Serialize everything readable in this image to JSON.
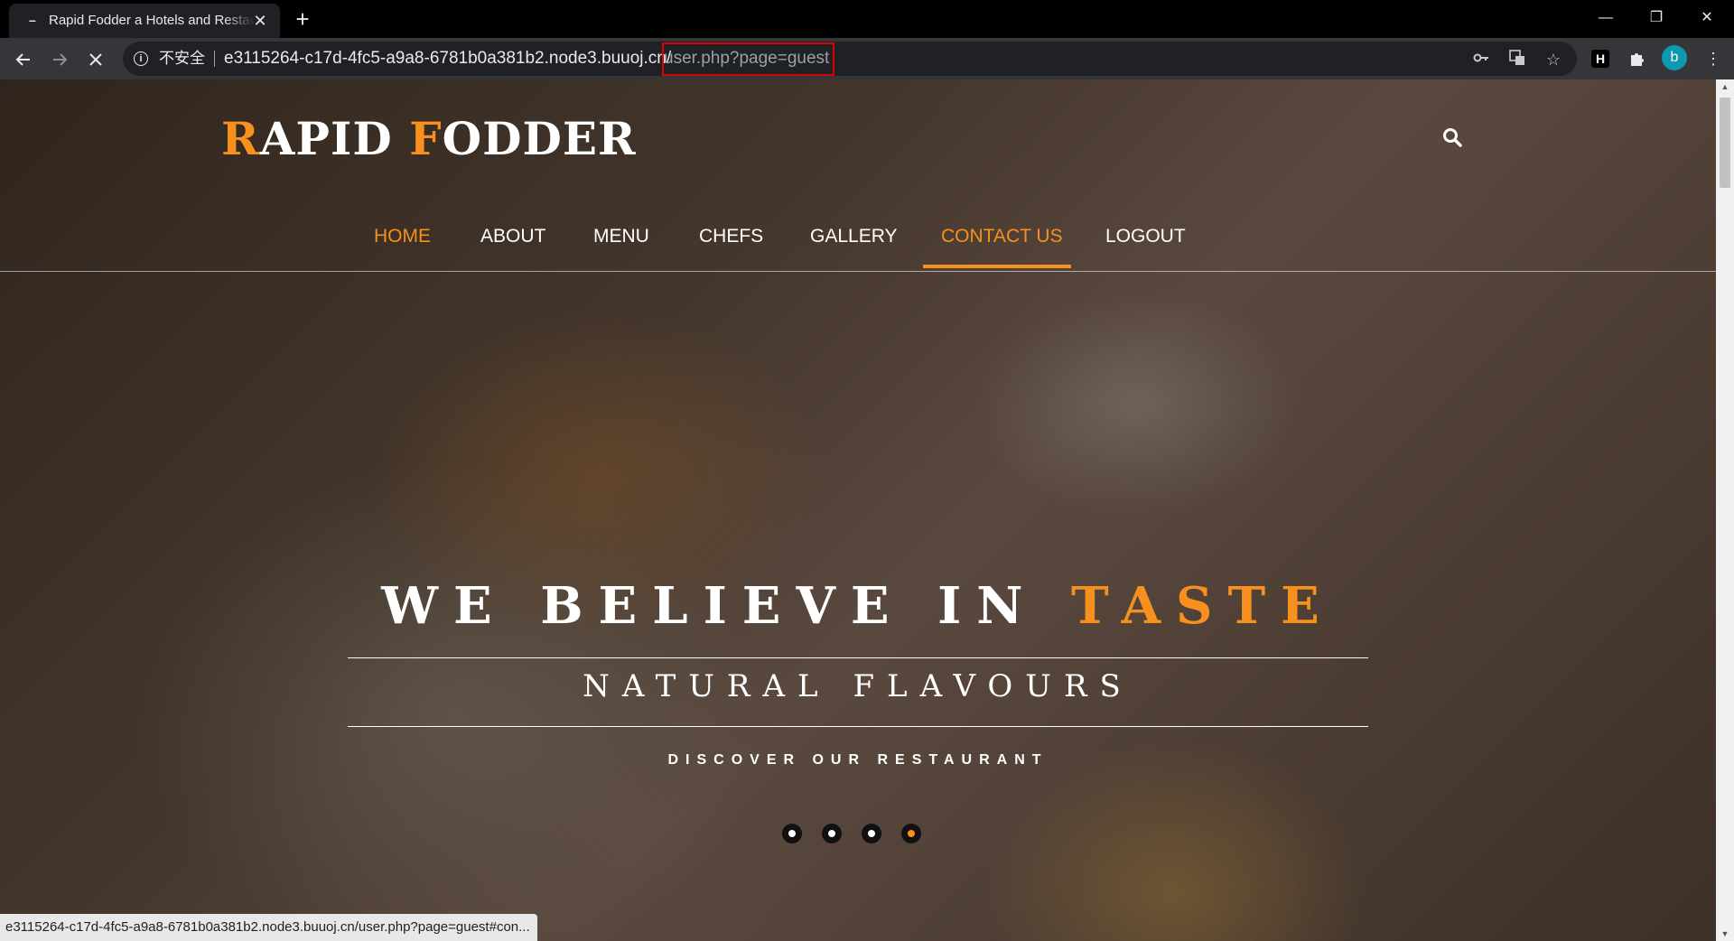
{
  "browser": {
    "tab_title": "Rapid Fodder a Hotels and Restaurants",
    "tab_close": "✕",
    "new_tab": "+",
    "security_label": "不安全",
    "url_host": "e3115264-c17d-4fc5-a9a8-6781b0a381b2.node3.buuoj.cn/",
    "url_path": "user.php?page=guest",
    "profile_initial": "b",
    "window_controls": {
      "minimize": "—",
      "restore": "❐",
      "close": "✕"
    },
    "status_url": "e3115264-c17d-4fc5-a9a8-6781b0a381b2.node3.buuoj.cn/user.php?page=guest#con..."
  },
  "site": {
    "brand": {
      "first_initial": "R",
      "first_rest": "APID ",
      "second_initial": "F",
      "second_rest": "ODDER"
    },
    "nav": [
      "HOME",
      "ABOUT",
      "MENU",
      "CHEFS",
      "GALLERY",
      "CONTACT US",
      "LOGOUT"
    ],
    "hero": {
      "title_main": "WE BELIEVE IN ",
      "title_accent": "TASTE",
      "subtitle": "NATURAL FLAVOURS",
      "cta": "DISCOVER OUR RESTAURANT"
    },
    "slider": {
      "count": 4,
      "active_index": 3
    }
  },
  "colors": {
    "accent": "#f7901e",
    "highlight_box": "#e00000",
    "profile": "#0d9ab0"
  }
}
